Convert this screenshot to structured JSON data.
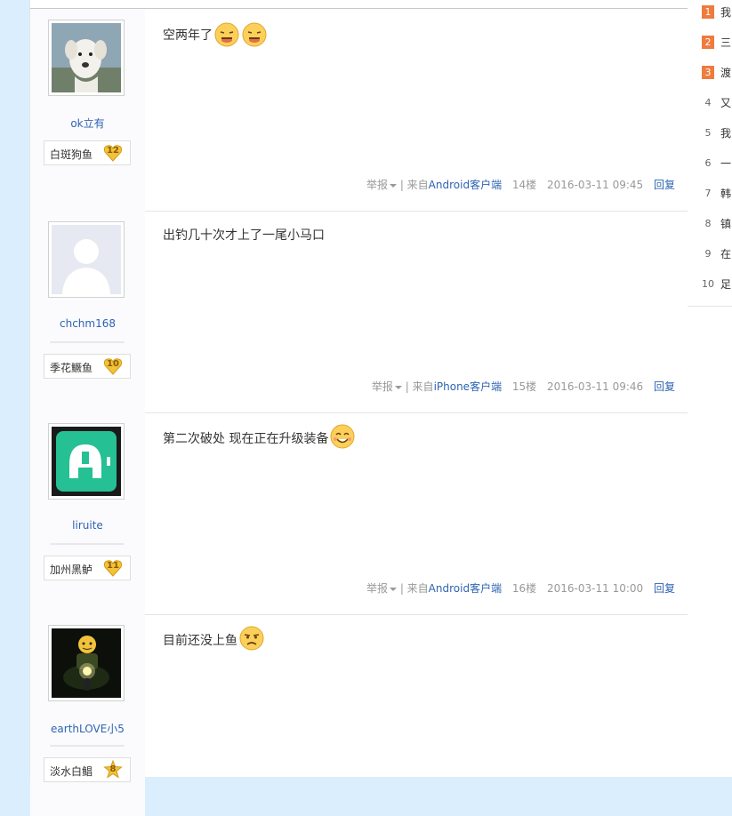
{
  "posts": [
    {
      "username": "ok立有",
      "badge_name": "白斑狗鱼",
      "level": "12",
      "content": "空两年了",
      "emoticons": [
        "tongue-face-icon",
        "tongue-face-icon"
      ],
      "report": "举报",
      "source_prefix": "| 来自",
      "source_client": "Android客户端",
      "floor": "14楼",
      "time": "2016-03-11 09:45",
      "reply": "回复"
    },
    {
      "username": "chchm168",
      "badge_name": "季花鳜鱼",
      "level": "10",
      "content": "出钓几十次才上了一尾小马口",
      "emoticons": [],
      "report": "举报",
      "source_prefix": "| 来自",
      "source_client": "iPhone客户端",
      "floor": "15楼",
      "time": "2016-03-11 09:46",
      "reply": "回复"
    },
    {
      "username": "liruite",
      "badge_name": "加州黑鲈",
      "level": "11",
      "content": "第二次破处 现在正在升级装备",
      "emoticons": [
        "happy-face-icon"
      ],
      "report": "举报",
      "source_prefix": "| 来自",
      "source_client": "Android客户端",
      "floor": "16楼",
      "time": "2016-03-11 10:00",
      "reply": "回复"
    },
    {
      "username": "earthLOVE小5",
      "badge_name": "淡水白鲳",
      "level": "8",
      "content": "目前还没上鱼",
      "emoticons": [
        "annoyed-face-icon"
      ],
      "report": "举报",
      "source_prefix": "",
      "source_client": "",
      "floor": "",
      "time": "",
      "reply": ""
    }
  ],
  "sidebar": {
    "hot_list": [
      {
        "rank": "1",
        "text": "我"
      },
      {
        "rank": "2",
        "text": "三"
      },
      {
        "rank": "3",
        "text": "渡"
      },
      {
        "rank": "4",
        "text": "又"
      },
      {
        "rank": "5",
        "text": "我"
      },
      {
        "rank": "6",
        "text": "一"
      },
      {
        "rank": "7",
        "text": "韩"
      },
      {
        "rank": "8",
        "text": "镇"
      },
      {
        "rank": "9",
        "text": "在"
      },
      {
        "rank": "10",
        "text": "足"
      }
    ]
  },
  "colors": {
    "page_bg": "#dbeefd",
    "link": "#2d64b3",
    "hot_rank": "#ef7b3e",
    "level_badge": "#f2c23a"
  }
}
